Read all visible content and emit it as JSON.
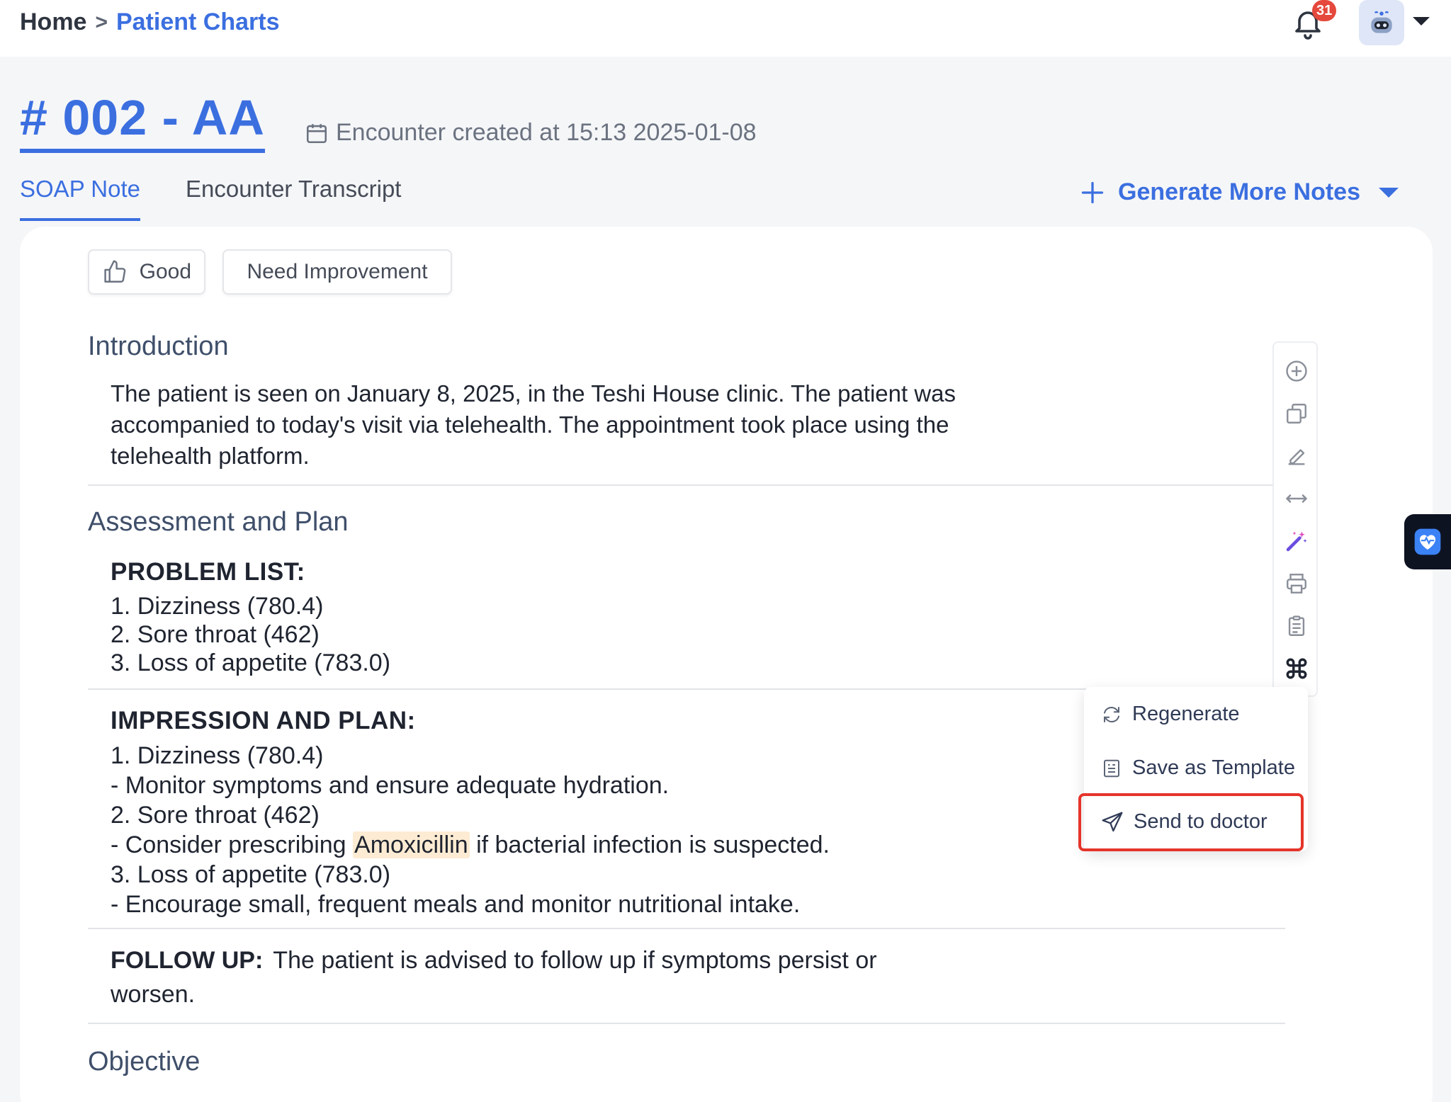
{
  "breadcrumb": {
    "home": "Home",
    "separator": ">",
    "current": "Patient Charts"
  },
  "notifications": {
    "count": "31",
    "icon": "bell-icon"
  },
  "encounter": {
    "title": "# 002 - AA",
    "created": "Encounter created at 15:13 2025-01-08"
  },
  "tabs": [
    {
      "label": "SOAP Note",
      "active": true
    },
    {
      "label": "Encounter Transcript",
      "active": false
    }
  ],
  "generate_more": {
    "label": "Generate More Notes"
  },
  "feedback": {
    "good": "Good",
    "improve": "Need Improvement"
  },
  "introduction": {
    "heading": "Introduction",
    "text": "The patient is seen on January 8, 2025, in the Teshi House clinic. The patient was accompanied to today's visit via telehealth. The appointment took place using the telehealth platform."
  },
  "assessment": {
    "heading": "Assessment and Plan",
    "problem_list": {
      "heading": "PROBLEM LIST:",
      "items": [
        "1. Dizziness (780.4)",
        "2. Sore throat (462)",
        "3. Loss of appetite (783.0)"
      ]
    },
    "impression": {
      "heading": "IMPRESSION AND PLAN:",
      "line1": "1. Dizziness (780.4)",
      "line2": "- Monitor symptoms and ensure adequate hydration.",
      "line3": "2. Sore throat (462)",
      "line4_pre": "- Consider prescribing ",
      "line4_drug": "Amoxicillin",
      "line4_post": " if bacterial infection is suspected.",
      "line5": "3. Loss of appetite (783.0)",
      "line6": "- Encourage small, frequent meals and monitor nutritional intake."
    },
    "follow_up": {
      "label": "FOLLOW UP:",
      "text": "The patient is advised to follow up if symptoms persist or worsen."
    }
  },
  "objective": {
    "heading": "Objective"
  },
  "toolbar_icons": [
    "add-circle-icon",
    "copy-icon",
    "edit-icon",
    "expand-width-icon",
    "magic-wand-icon",
    "print-icon",
    "clipboard-icon",
    "command-icon"
  ],
  "menu": {
    "regenerate": "Regenerate",
    "save_template": "Save as Template",
    "send_doctor": "Send to doctor"
  },
  "colors": {
    "accent": "#3b6fe0",
    "highlight_border": "#e5342a",
    "drug_highlight": "#fdecd3"
  }
}
